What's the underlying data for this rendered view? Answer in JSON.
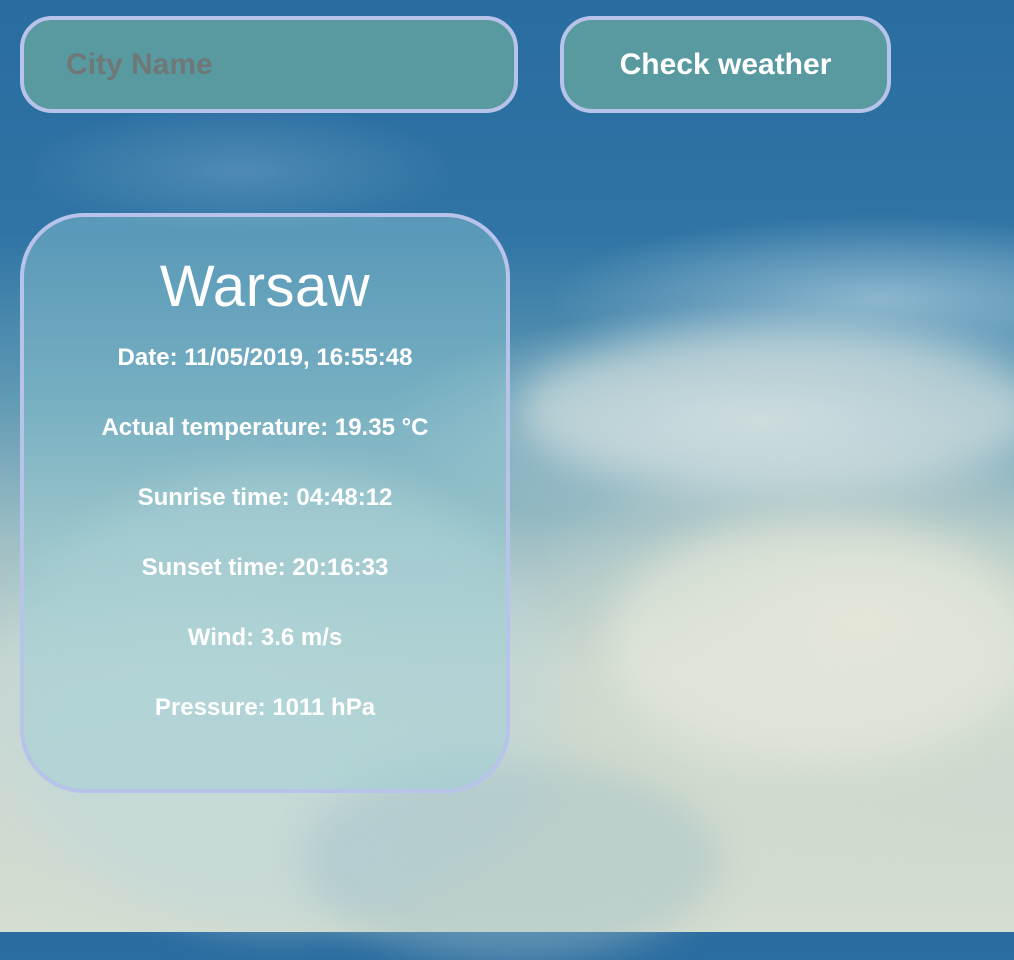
{
  "search": {
    "placeholder": "City Name",
    "value": ""
  },
  "actions": {
    "check_label": "Check weather"
  },
  "weather": {
    "city": "Warsaw",
    "date": "Date: 11/05/2019, 16:55:48",
    "temperature": "Actual temperature: 19.35 °C",
    "sunrise": "Sunrise time: 04:48:12",
    "sunset": "Sunset time: 20:16:33",
    "wind": "Wind: 3.6 m/s",
    "pressure": "Pressure: 1011 hPa"
  },
  "colors": {
    "control_fill": "#60a0a0",
    "border": "#b8c3ea",
    "text": "#ffffff",
    "placeholder": "#6e7876"
  }
}
